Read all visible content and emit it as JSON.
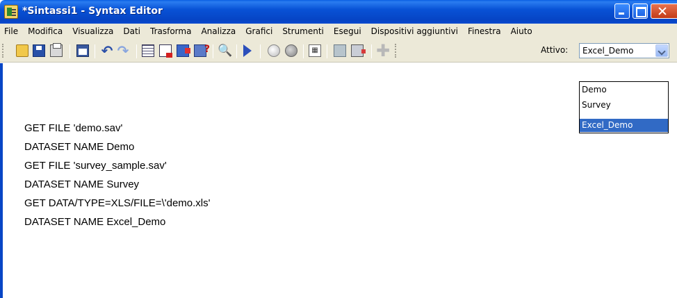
{
  "window": {
    "title": "*Sintassi1 - Syntax Editor"
  },
  "menu": [
    "File",
    "Modifica",
    "Visualizza",
    "Dati",
    "Trasforma",
    "Analizza",
    "Grafici",
    "Strumenti",
    "Esegui",
    "Dispositivi aggiuntivi",
    "Finestra",
    "Aiuto"
  ],
  "toolbar": {
    "active_label": "Attivo:",
    "active_value": "Excel_Demo",
    "icons": [
      "open-icon",
      "save-icon",
      "print-icon",
      "recall-dialog-icon",
      "undo-icon",
      "redo-icon",
      "go-to-data-icon",
      "go-to-case-icon",
      "insert-variable-icon",
      "variables-info-icon",
      "find-icon",
      "run-icon",
      "use-sets-icon",
      "show-all-variables-icon",
      "syntax-help-icon",
      "select-cases-icon",
      "compute-icon",
      "add-icon"
    ]
  },
  "dropdown": {
    "options": [
      "Demo",
      "Survey",
      "Excel_Demo"
    ],
    "selected": "Excel_Demo"
  },
  "editor": {
    "lines": [
      "GET FILE 'demo.sav'",
      "DATASET NAME Demo",
      "GET FILE 'survey_sample.sav'",
      "DATASET NAME Survey",
      "GET DATA/TYPE=XLS/FILE=\\'demo.xls'",
      "DATASET NAME Excel_Demo"
    ]
  },
  "colors": {
    "titlebar": "#0852d6",
    "menubar": "#ece9d8",
    "selection": "#316ac5"
  }
}
